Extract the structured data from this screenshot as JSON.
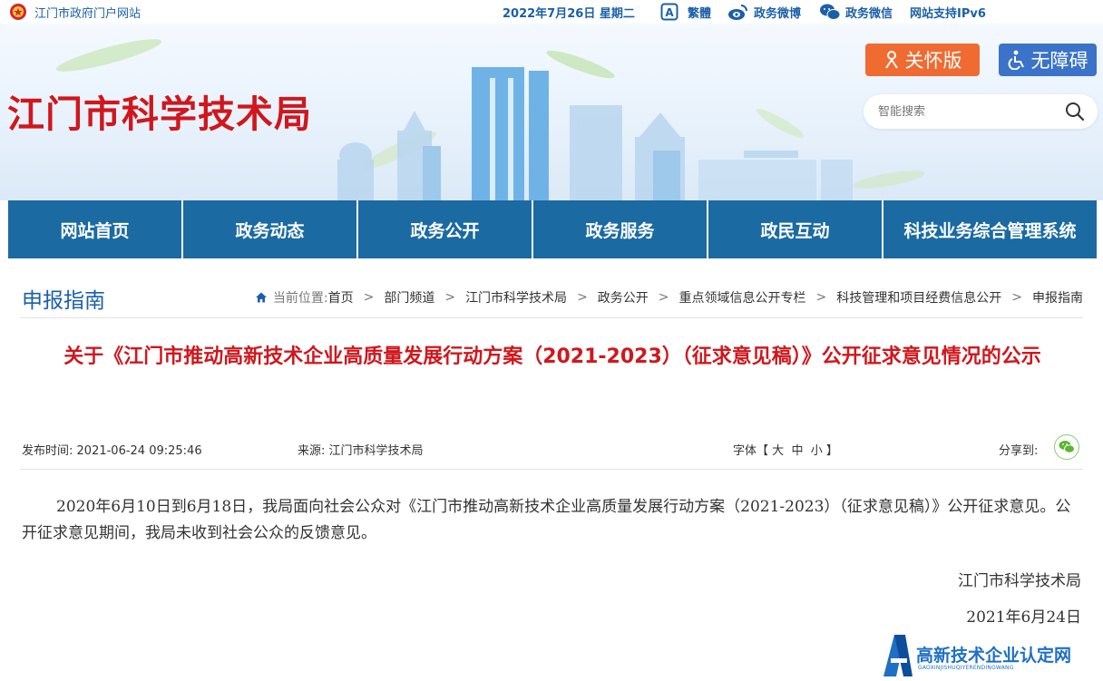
{
  "topbar": {
    "portal_link": "江门市政府门户网站",
    "date": "2022年7月26日 星期二",
    "traditional": "繁體",
    "weibo": "政务微博",
    "wechat": "政务微信",
    "ipv6": "网站支持IPv6"
  },
  "header": {
    "site_title": "江门市科学技术局",
    "care_button": "关怀版",
    "accessibility_button": "无障碍",
    "search_placeholder": "智能搜索"
  },
  "nav": {
    "items": [
      {
        "label": "网站首页"
      },
      {
        "label": "政务动态"
      },
      {
        "label": "政务公开"
      },
      {
        "label": "政务服务"
      },
      {
        "label": "政民互动"
      },
      {
        "label": "科技业务综合管理系统"
      }
    ]
  },
  "location": {
    "section_title": "申报指南",
    "current_label": "当前位置:",
    "crumbs": [
      "首页",
      "部门频道",
      "江门市科学技术局",
      "政务公开",
      "重点领域信息公开专栏",
      "科技管理和项目经费信息公开",
      "申报指南"
    ]
  },
  "article": {
    "title": "关于《江门市推动高新技术企业高质量发展行动方案（2021-2023）（征求意见稿）》公开征求意见情况的公示",
    "published_label": "发布时间:",
    "published": "2021-06-24 09:25:46",
    "source_label": "来源:",
    "source": "江门市科学技术局",
    "font_label": "字体【",
    "font_large": "大",
    "font_medium": "中",
    "font_small": "小",
    "font_close": "】",
    "share_label": "分享到:",
    "body": "2020年6月10日到6月18日，我局面向社会公众对《江门市推动高新技术企业高质量发展行动方案（2021-2023）（征求意见稿）》公开征求意见。公开征求意见期间，我局未收到社会公众的反馈意见。",
    "sign_org": "江门市科学技术局",
    "sign_date": "2021年6月24日"
  },
  "watermark": {
    "main": "高新技术企业认定网",
    "sub": "GAOXINJISHUQIYERENDINGWANG"
  },
  "colors": {
    "nav_bg": "#1b6aa2",
    "title_red": "#d0171d",
    "link_blue": "#1b5fa8",
    "care_orange": "#ef6b32",
    "access_blue": "#3a73c9"
  }
}
